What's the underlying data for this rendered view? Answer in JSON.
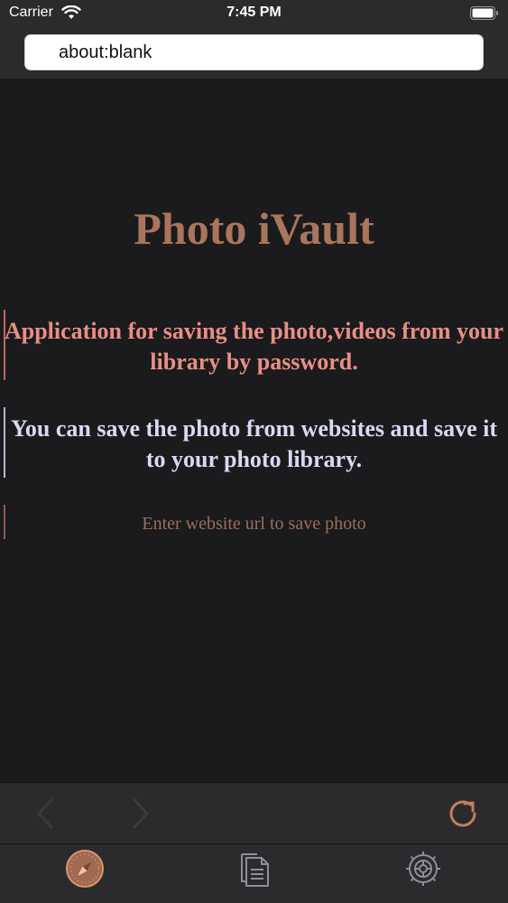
{
  "status_bar": {
    "carrier": "Carrier",
    "time": "7:45 PM",
    "wifi_icon": "wifi-icon",
    "battery_icon": "battery-icon"
  },
  "url_bar": {
    "value": "about:blank"
  },
  "page": {
    "title": "Photo iVault",
    "description_1": "Application for saving the photo,videos from your library by password.",
    "description_2": "You can save the photo from websites and save it to your photo library.",
    "hint": "Enter website url to save photo"
  },
  "toolbar": {
    "back_icon": "chevron-left-icon",
    "forward_icon": "chevron-right-icon",
    "reload_icon": "reload-icon"
  },
  "tab_bar": {
    "items": [
      {
        "icon": "compass-icon"
      },
      {
        "icon": "documents-icon"
      },
      {
        "icon": "gear-icon"
      }
    ]
  },
  "colors": {
    "accent": "#a8755d",
    "description_1": "#e88f85",
    "description_2": "#d7daf3",
    "hint": "#9a6f5e",
    "background": "#1b1a1c",
    "bars": "#2b2a2c"
  }
}
